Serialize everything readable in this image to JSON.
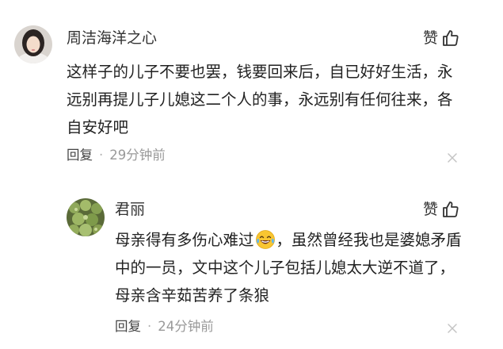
{
  "comments": [
    {
      "username": "周洁海洋之心",
      "like_label": "赞",
      "text": "这样子的儿子不要也罢，钱要回来后，自已好好生活，永远别再提儿子儿媳这二个人的事，永远别有任何往来，各自安好吧",
      "reply_label": "回复",
      "separator": "·",
      "time": "29分钟前"
    },
    {
      "username": "君丽",
      "like_label": "赞",
      "text_before": "母亲得有多伤心难过",
      "emoji": "laughing-tears-emoji",
      "text_after": "，虽然曾经我也是婆媳矛盾中的一员，文中这个儿子包括儿媳太大逆不道了，母亲含辛茹苦养了条狼",
      "reply_label": "回复",
      "separator": "·",
      "time": "24分钟前"
    }
  ],
  "colors": {
    "text": "#222222",
    "muted": "#999999",
    "icon": "#333333"
  }
}
